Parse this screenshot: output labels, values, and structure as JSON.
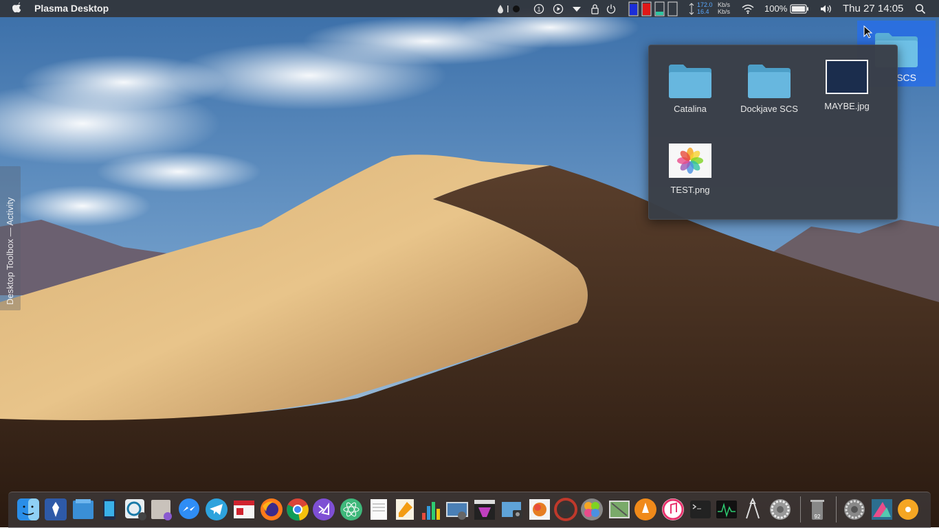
{
  "app_title": "Plasma Desktop",
  "menubar": {
    "network_up": "172.0",
    "network_down": "16.4",
    "network_unit_up": "Kb/s",
    "network_unit_down": "Kb/s",
    "battery_percent": "100%",
    "clock": "Thu 27  14:05"
  },
  "side_panel": {
    "label": "Desktop Toolbox — Activity"
  },
  "desktop_item": {
    "label": "SCS"
  },
  "popup": {
    "items": [
      {
        "label": "Catalina",
        "type": "folder"
      },
      {
        "label": "Dockjave SCS",
        "type": "folder"
      },
      {
        "label": "MAYBE.jpg",
        "type": "image"
      },
      {
        "label": "TEST.png",
        "type": "image"
      }
    ]
  },
  "dock": {
    "apps": [
      "finder",
      "plasma-discover",
      "file-manager",
      "kdeconnect",
      "sound-settings",
      "preview-tool",
      "messenger",
      "telegram",
      "news-reader",
      "firefox",
      "chrome",
      "visual-studio",
      "atom",
      "text-editor",
      "pages",
      "numbers",
      "image-viewer",
      "final-cut",
      "image-capture",
      "pixel-editor",
      "photo-capture",
      "photos",
      "preview",
      "vlc",
      "itunes",
      "terminal",
      "activity-monitor",
      "utilities",
      "system-preferences",
      "trash",
      "settings",
      "kde-store",
      "cd-player"
    ],
    "trash_badge": "92"
  }
}
